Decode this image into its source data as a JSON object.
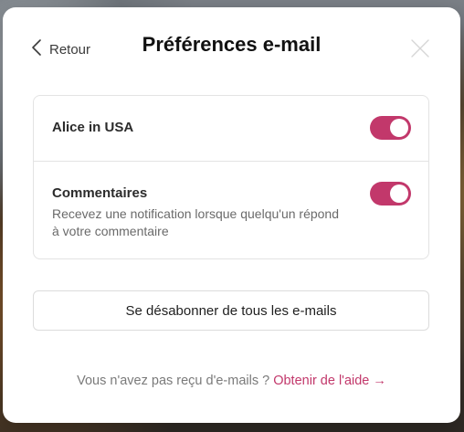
{
  "modal": {
    "back_label": "Retour",
    "title": "Préférences e-mail"
  },
  "preferences": [
    {
      "title": "Alice in USA",
      "description": "",
      "enabled": true
    },
    {
      "title": "Commentaires",
      "description": "Recevez une notification lorsque quelqu'un répond à votre commentaire",
      "enabled": true
    }
  ],
  "unsubscribe_label": "Se désabonner de tous les e-mails",
  "help": {
    "question": "Vous n'avez pas reçu d'e-mails ?",
    "link_label": "Obtenir de l'aide →"
  },
  "colors": {
    "accent": "#c2386b",
    "toggle_knob": "#ffffff",
    "border": "#e3e3e3"
  },
  "icons": {
    "back": "chevron-left-icon",
    "close": "close-icon"
  }
}
